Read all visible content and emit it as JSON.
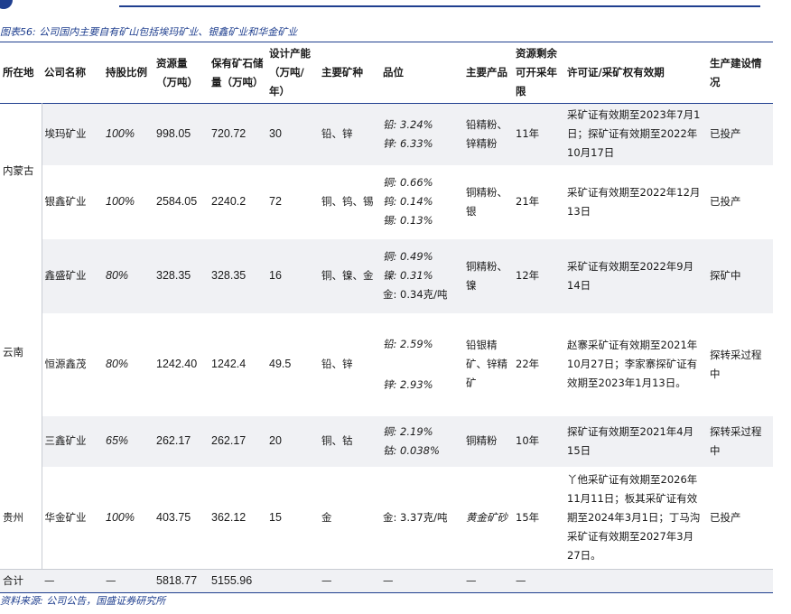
{
  "caption": "图表56: 公司国内主要自有矿山包括埃玛矿业、银鑫矿业和华金矿业",
  "source": "资料来源: 公司公告，国盛证券研究所",
  "headers": {
    "location": "所在地",
    "company": "公司名称",
    "holding": "持股比例",
    "resource": "资源量（万吨）",
    "reserve": "保有矿石储量（万吨）",
    "capacity": "设计产能（万吨/年）",
    "mineral": "主要矿种",
    "grade": "品位",
    "product": "主要产品",
    "years": "资源剩余可开采年限",
    "license": "许可证/采矿权有效期",
    "status": "生产建设情况"
  },
  "regions": [
    "内蒙古",
    "云南",
    "贵州"
  ],
  "rows": [
    {
      "company": "埃玛矿业",
      "holding": "100%",
      "resource": "998.05",
      "reserve": "720.72",
      "capacity": "30",
      "mineral": "铅、锌",
      "grades": [
        "铅: 3.24%",
        "锌: 6.33%"
      ],
      "product": "铅精粉、锌精粉",
      "years": "11年",
      "license": "采矿证有效期至2023年7月1日；探矿证有效期至2022年10月17日",
      "status": "已投产"
    },
    {
      "company": "银鑫矿业",
      "holding": "100%",
      "resource": "2584.05",
      "reserve": "2240.2",
      "capacity": "72",
      "mineral": "铜、钨、锡",
      "grades": [
        "铜: 0.66%",
        "钨: 0.14%",
        "锡: 0.13%"
      ],
      "product": "铜精粉、银",
      "years": "21年",
      "license": "采矿证有效期至2022年12月13日",
      "status": "已投产"
    },
    {
      "company": "鑫盛矿业",
      "holding": "80%",
      "resource": "328.35",
      "reserve": "328.35",
      "capacity": "16",
      "mineral": "铜、镍、金",
      "grades": [
        "铜: 0.49%",
        "镍: 0.31%",
        "金: 0.34克/吨"
      ],
      "product": "铜精粉、镍",
      "years": "12年",
      "license": "采矿证有效期至2022年9月14日",
      "status": "探矿中"
    },
    {
      "company": "恒源鑫茂",
      "holding": "80%",
      "resource": "1242.40",
      "reserve": "1242.4",
      "capacity": "49.5",
      "mineral": "铅、锌",
      "grades": [
        "铅: 2.59%",
        "锌: 2.93%"
      ],
      "product": "铅银精矿、锌精矿",
      "years": "22年",
      "license": "赵寨采矿证有效期至2021年10月27日；李家寨探矿证有效期至2023年1月13日。",
      "status": "探转采过程中"
    },
    {
      "company": "三鑫矿业",
      "holding": "65%",
      "resource": "262.17",
      "reserve": "262.17",
      "capacity": "20",
      "mineral": "铜、钴",
      "grades": [
        "铜: 2.19%",
        "钴: 0.038%"
      ],
      "product": "铜精粉",
      "years": "10年",
      "license": "探矿证有效期至2021年4月15日",
      "status": "探转采过程中"
    },
    {
      "company": "华金矿业",
      "holding": "100%",
      "resource": "403.75",
      "reserve": "362.12",
      "capacity": "15",
      "mineral": "金",
      "grades": [
        "金: 3.37克/吨"
      ],
      "product": "黄金矿砂",
      "years": "15年",
      "license": "丫他采矿证有效期至2026年11月11日；板其采矿证有效期至2024年3月1日；丁马沟采矿证有效期至2027年3月27日。",
      "status": "已投产"
    }
  ],
  "total": {
    "label": "合计",
    "company": "—",
    "holding": "—",
    "resource": "5818.77",
    "reserve": "5155.96",
    "capacity": "",
    "mineral": "—",
    "grade": "—",
    "product": "—",
    "years": "—",
    "license": "",
    "status": ""
  }
}
